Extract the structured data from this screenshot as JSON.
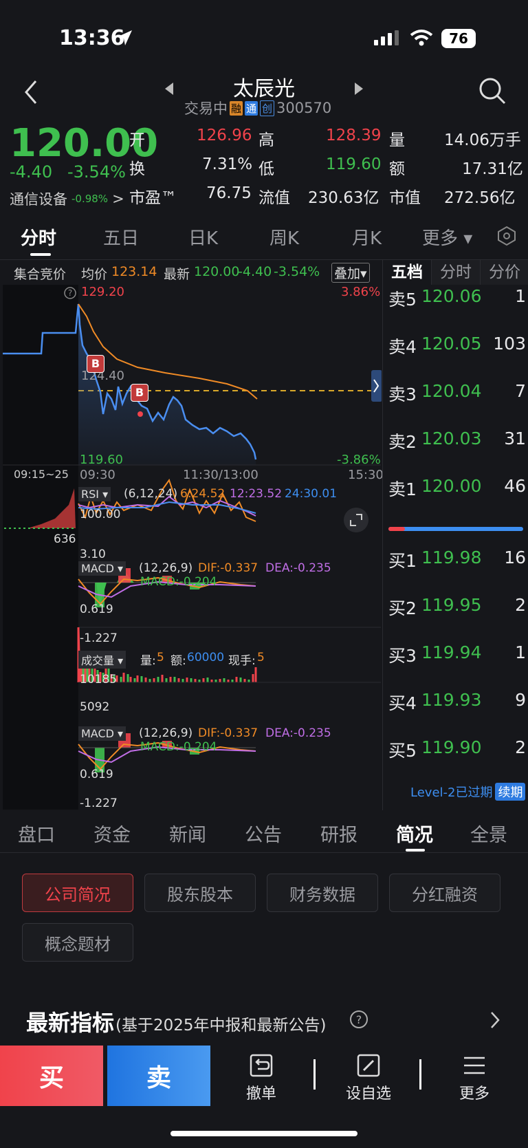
{
  "status": {
    "time": "13:36",
    "battery": "76"
  },
  "nav": {
    "title": "太辰光",
    "state": "交易中",
    "badges": [
      "融",
      "通",
      "创"
    ],
    "code": "300570"
  },
  "quote": {
    "price": "120.00",
    "change": "-4.40",
    "change_pct": "-3.54%",
    "sector": "通信设备",
    "sector_pct": "-0.98%",
    "open_label": "开",
    "open": "126.96",
    "high_label": "高",
    "high": "128.39",
    "volume_label": "量",
    "volume": "14.06万手",
    "turnover_label": "换",
    "turnover": "7.31%",
    "low_label": "低",
    "low": "119.60",
    "amount_label": "额",
    "amount": "17.31亿",
    "pe_label": "市盈™",
    "pe": "76.75",
    "float_label": "流值",
    "float_cap": "230.63亿",
    "mcap_label": "市值",
    "mcap": "272.56亿"
  },
  "tabs": [
    "分时",
    "五日",
    "日K",
    "周K",
    "月K",
    "更多 ▾"
  ],
  "infobar": {
    "auction": "集合竞价",
    "avg_label": "均价",
    "avg": "123.14",
    "latest_label": "最新",
    "latest": "120.00",
    "chg": "-4.40",
    "pct": "-3.54%",
    "overlay": "叠加▾"
  },
  "chart": {
    "top_price": "129.20",
    "top_pct": "3.86%",
    "mid_price": "124.40",
    "low_price": "119.60",
    "low_pct": "-3.86%",
    "x_labels": [
      "09:15~25",
      "09:30",
      "11:30/13:00",
      "15:30"
    ],
    "marker": "B",
    "rsi": {
      "label": "RSI ▾",
      "params": "(6,12,24)",
      "r6": "6:24.52",
      "r12": "12:23.52",
      "r24": "24:30.01",
      "top": "100.00",
      "low": "3.10",
      "aux": "636"
    },
    "macd": {
      "label": "MACD ▾",
      "params": "(12,26,9)",
      "dif": "DIF:-0.337",
      "dea": "DEA:-0.235",
      "macd": "MACD:-0.204",
      "top": "0.619",
      "low": "-1.227"
    },
    "vol": {
      "label": "成交量 ▾",
      "qty_label": "量:",
      "qty": "5",
      "amt_label": "额:",
      "amt": "60000",
      "hand_label": "现手:",
      "hand": "5",
      "top": "10185",
      "mid": "5092"
    }
  },
  "book": {
    "tabs": [
      "五档",
      "分时",
      "分价"
    ],
    "asks": [
      {
        "l": "卖5",
        "p": "120.06",
        "q": "1"
      },
      {
        "l": "卖4",
        "p": "120.05",
        "q": "103"
      },
      {
        "l": "卖3",
        "p": "120.04",
        "q": "7"
      },
      {
        "l": "卖2",
        "p": "120.03",
        "q": "31"
      },
      {
        "l": "卖1",
        "p": "120.00",
        "q": "46"
      }
    ],
    "bids": [
      {
        "l": "买1",
        "p": "119.98",
        "q": "16"
      },
      {
        "l": "买2",
        "p": "119.95",
        "q": "2"
      },
      {
        "l": "买3",
        "p": "119.94",
        "q": "1"
      },
      {
        "l": "买4",
        "p": "119.93",
        "q": "9"
      },
      {
        "l": "买5",
        "p": "119.90",
        "q": "2"
      }
    ],
    "level2": "Level-2已过期",
    "renew": "续期"
  },
  "subtabs": [
    "盘口",
    "资金",
    "新闻",
    "公告",
    "研报",
    "简况",
    "全景"
  ],
  "pills": [
    "公司简况",
    "股东股本",
    "财务数据",
    "分红融资",
    "概念题材"
  ],
  "latest": {
    "title": "最新指标",
    "subtitle": "(基于2025年中报和最新公告)"
  },
  "bottom": {
    "buy": "买",
    "sell": "卖",
    "cancel": "撤单",
    "watch": "设自选",
    "more": "更多"
  },
  "colors": {
    "up": "#f0434b",
    "down": "#3fbf4f",
    "accent": "#3d8ef0",
    "avg_line": "#f08b26"
  }
}
